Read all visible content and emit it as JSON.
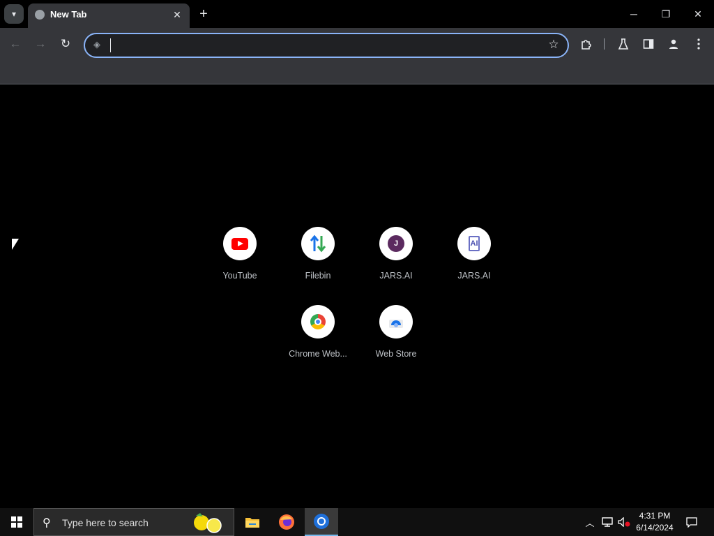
{
  "browser": {
    "tab": {
      "title": "New Tab"
    },
    "new_tab_label": "+",
    "window_controls": {
      "minimize": "─",
      "restore": "❐",
      "close": "✕"
    },
    "nav": {
      "back": "←",
      "forward": "→",
      "reload": "↻"
    },
    "omnibox": {
      "value": "",
      "placeholder": ""
    },
    "bookmark_star": "☆"
  },
  "shortcuts": [
    {
      "label": "YouTube",
      "icon": "youtube-icon"
    },
    {
      "label": "Filebin",
      "icon": "filebin-icon"
    },
    {
      "label": "JARS.AI",
      "icon": "jars-j-icon",
      "icon_text": "J"
    },
    {
      "label": "JARS.AI",
      "icon": "jars-ai-icon",
      "icon_text": "AI"
    },
    {
      "label": "Chrome Web...",
      "icon": "chrome-webstore-icon"
    },
    {
      "label": "Web Store",
      "icon": "webstore-icon"
    }
  ],
  "taskbar": {
    "search_placeholder": "Type here to search",
    "apps": [
      "file-explorer-icon",
      "firefox-icon",
      "chrome-icon"
    ],
    "active_app": "chrome-icon",
    "clock": {
      "time": "4:31 PM",
      "date": "6/14/2024"
    }
  },
  "colors": {
    "accent": "#8ab4f8",
    "toolbar": "#35363a",
    "page": "#000000"
  }
}
